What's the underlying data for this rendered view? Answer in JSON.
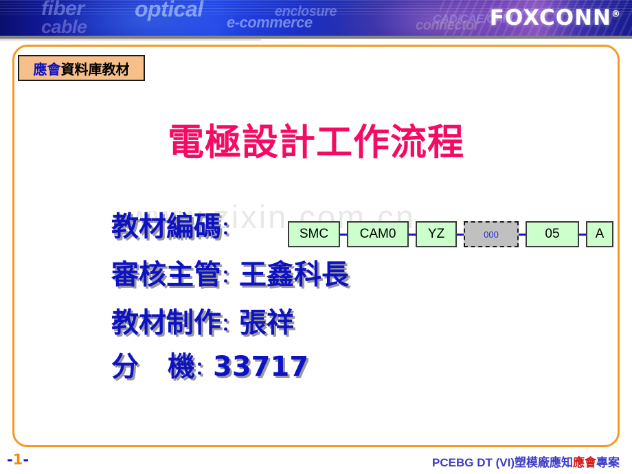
{
  "header": {
    "logo_text": "FOXCONN",
    "logo_registered": "®",
    "keywords": [
      {
        "name": "fiber",
        "text": "fiber"
      },
      {
        "name": "optical",
        "text": "optical"
      },
      {
        "name": "enclosure",
        "text": "enclosure"
      },
      {
        "name": "e-commerce",
        "text": "e-commerce"
      },
      {
        "name": "cable",
        "text": "cable"
      },
      {
        "name": "cad-cae-cam",
        "text": "CAD/CAE/CAM"
      },
      {
        "name": "connector",
        "text": "connector"
      }
    ]
  },
  "badge": {
    "highlight": "應會",
    "rest": "資料庫教材",
    "full": "應會資料庫教材"
  },
  "watermark": {
    "text": "www.zixin.com.cn"
  },
  "slide": {
    "title": "電極設計工作流程",
    "lines": [
      {
        "label": "教材編碼",
        "colon": "：",
        "value": ""
      },
      {
        "label": "審核主管",
        "colon": "：",
        "value": "王鑫科長"
      },
      {
        "label": "教材制作",
        "colon": "：",
        "value": "張祥"
      },
      {
        "label": "分",
        "colon": "：",
        "value": "33717",
        "label2": "機"
      }
    ]
  },
  "code_boxes": [
    {
      "name": "box-smc",
      "text": "SMC",
      "style": "solid",
      "width": 76
    },
    {
      "name": "box-cam0",
      "text": "CAM0",
      "style": "solid",
      "width": 90
    },
    {
      "name": "box-yz",
      "text": "YZ",
      "style": "solid",
      "width": 60
    },
    {
      "name": "box-000",
      "text": "000",
      "style": "dashed",
      "width": 80
    },
    {
      "name": "box-05",
      "text": "05",
      "style": "solid",
      "width": 78
    },
    {
      "name": "box-a",
      "text": "A",
      "style": "solid",
      "width": 40
    }
  ],
  "footer": {
    "page_prefix": "-",
    "page_number": "1",
    "page_suffix": "-",
    "text_before": "PCEBG DT (VI)塑模廠應知",
    "text_red": "應會",
    "text_after": "專案"
  },
  "colors": {
    "accent_orange": "#f59a1e",
    "title_pink": "#f50a64",
    "text_blue": "#0d12c4",
    "box_green": "#ccffcc",
    "box_gray": "#c0c0c0",
    "footer_red": "#d41414"
  }
}
